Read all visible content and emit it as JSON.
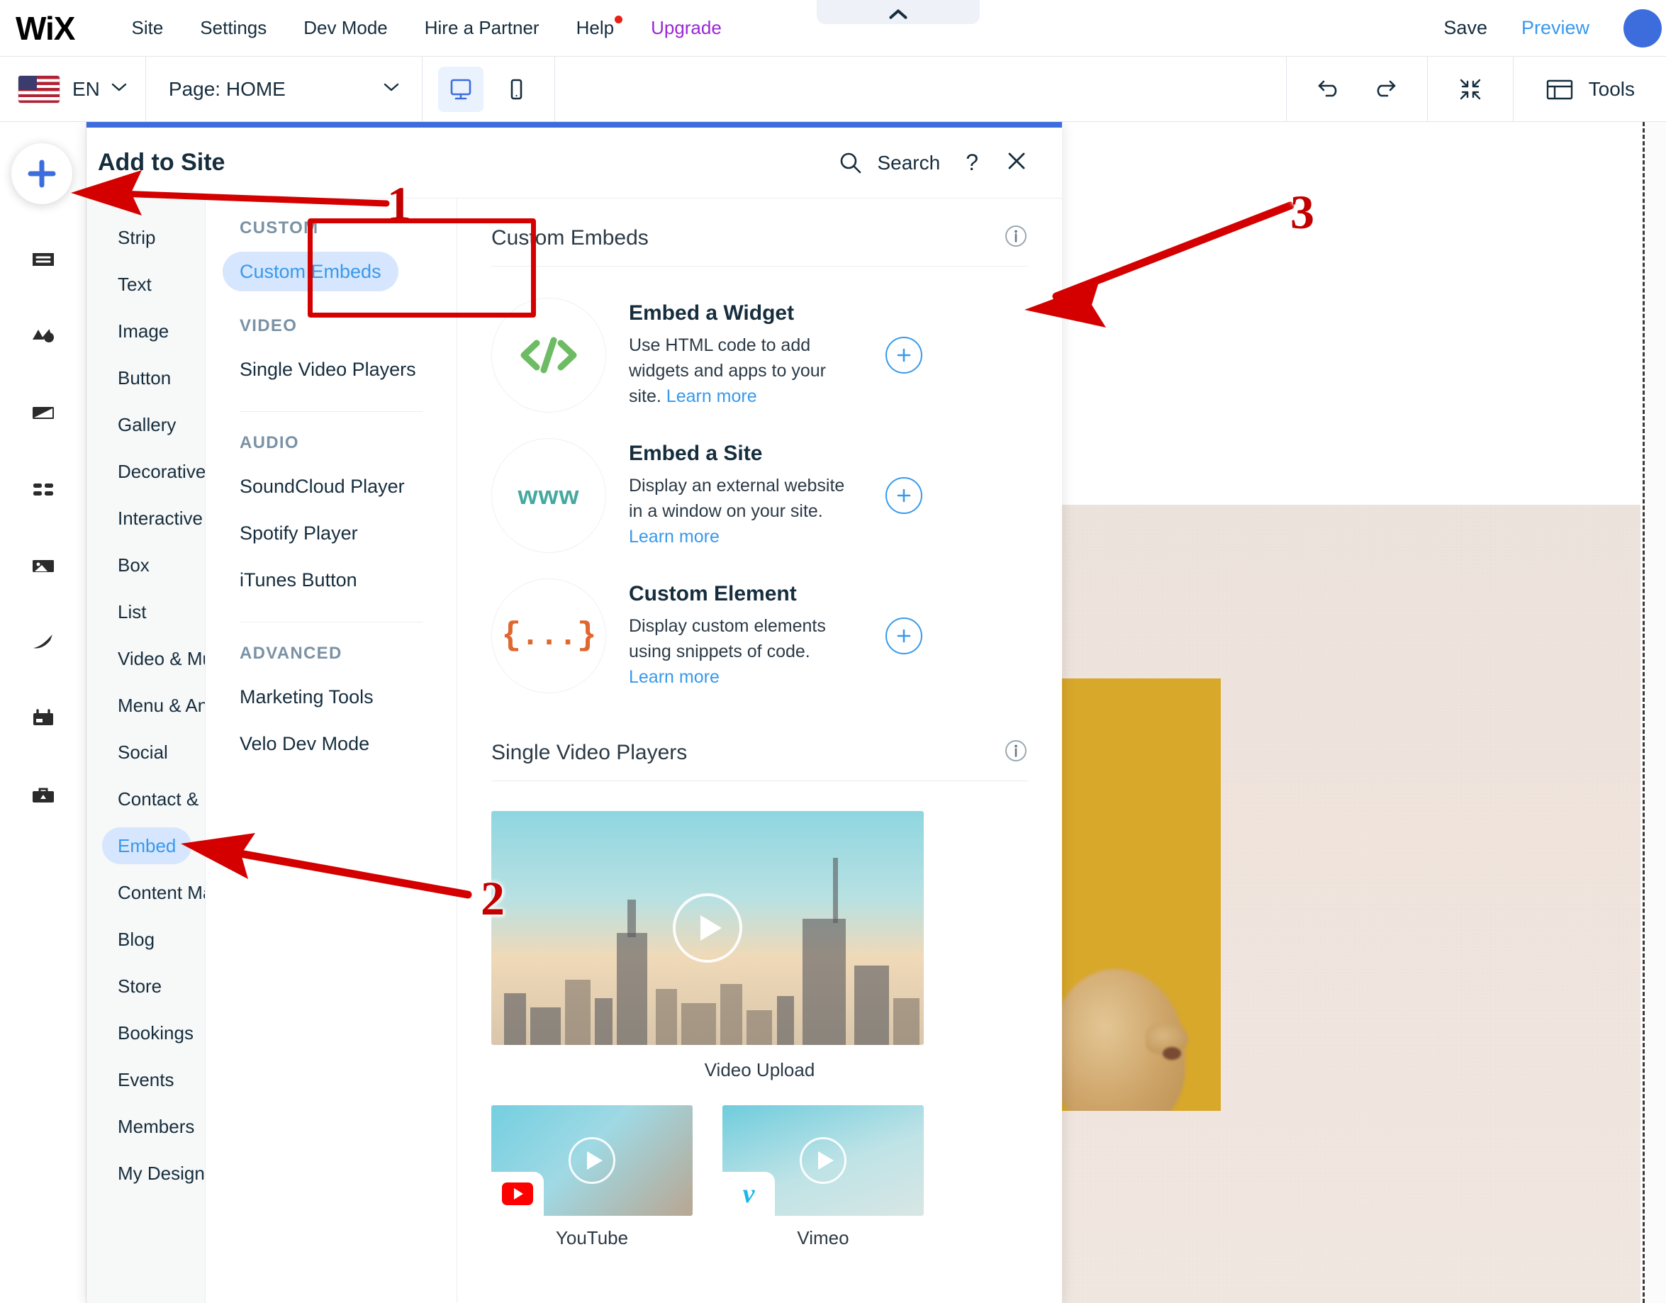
{
  "topbar": {
    "logo": "WiX",
    "nav": [
      {
        "label": "Site",
        "badge": false
      },
      {
        "label": "Settings",
        "badge": false
      },
      {
        "label": "Dev Mode",
        "badge": false
      },
      {
        "label": "Hire a Partner",
        "badge": false
      },
      {
        "label": "Help",
        "badge": true
      },
      {
        "label": "Upgrade",
        "badge": false
      }
    ],
    "save_label": "Save",
    "preview_label": "Preview"
  },
  "secondbar": {
    "language": "EN",
    "page_label": "Page: HOME",
    "tools_label": "Tools"
  },
  "panel": {
    "title": "Add to Site",
    "search_label": "Search",
    "help_label": "?",
    "categories": [
      {
        "label": "Strip",
        "selected": false
      },
      {
        "label": "Text",
        "selected": false
      },
      {
        "label": "Image",
        "selected": false
      },
      {
        "label": "Button",
        "selected": false
      },
      {
        "label": "Gallery",
        "selected": false
      },
      {
        "label": "Decorative",
        "selected": false
      },
      {
        "label": "Interactive",
        "selected": false
      },
      {
        "label": "Box",
        "selected": false
      },
      {
        "label": "List",
        "selected": false
      },
      {
        "label": "Video & Music",
        "selected": false
      },
      {
        "label": "Menu & Anchor",
        "selected": false
      },
      {
        "label": "Social",
        "selected": false
      },
      {
        "label": "Contact & Forms",
        "selected": false
      },
      {
        "label": "Embed",
        "selected": true
      },
      {
        "label": "Content Manager",
        "selected": false
      },
      {
        "label": "Blog",
        "selected": false
      },
      {
        "label": "Store",
        "selected": false
      },
      {
        "label": "Bookings",
        "selected": false
      },
      {
        "label": "Events",
        "selected": false
      },
      {
        "label": "Members",
        "selected": false
      },
      {
        "label": "My Designs",
        "selected": false
      }
    ],
    "groups": [
      {
        "title": "CUSTOM",
        "items": [
          {
            "label": "Custom Embeds",
            "selected": true
          }
        ],
        "divider_after": false
      },
      {
        "title": "VIDEO",
        "items": [
          {
            "label": "Single Video Players",
            "selected": false
          }
        ],
        "divider_after": true
      },
      {
        "title": "AUDIO",
        "items": [
          {
            "label": "SoundCloud Player",
            "selected": false
          },
          {
            "label": "Spotify Player",
            "selected": false
          },
          {
            "label": "iTunes Button",
            "selected": false
          }
        ],
        "divider_after": true
      },
      {
        "title": "ADVANCED",
        "items": [
          {
            "label": "Marketing Tools",
            "selected": false
          },
          {
            "label": "Velo Dev Mode",
            "selected": false
          }
        ],
        "divider_after": false
      }
    ],
    "sections": [
      {
        "heading": "Custom Embeds",
        "items": [
          {
            "name": "Embed a Widget",
            "desc": "Use HTML code to add widgets and apps to your site. ",
            "link": "Learn more",
            "icon": "code-icon"
          },
          {
            "name": "Embed a Site",
            "desc": "Display an external website in a window on your site. ",
            "link": "Learn more",
            "icon": "www-icon"
          },
          {
            "name": "Custom Element",
            "desc": "Display custom elements using snippets of code. ",
            "link": "Learn more",
            "icon": "braces-icon"
          }
        ]
      },
      {
        "heading": "Single Video Players",
        "videos": [
          {
            "label": "Video Upload",
            "badge": "none"
          },
          {
            "label": "YouTube",
            "badge": "youtube"
          },
          {
            "label": "Vimeo",
            "badge": "vimeo"
          }
        ]
      }
    ]
  },
  "annotations": [
    {
      "number": "1"
    },
    {
      "number": "2"
    },
    {
      "number": "3"
    }
  ],
  "colors": {
    "accent_blue": "#3899ec",
    "panel_top_blue": "#3d6ddd",
    "upgrade_purple": "#9a27d5",
    "annotation_red": "#c20000",
    "pill_blue_bg": "#d6e6fe",
    "code_green": "#6dbb63",
    "www_teal": "#45a9a0",
    "braces_orange": "#e0672e"
  }
}
